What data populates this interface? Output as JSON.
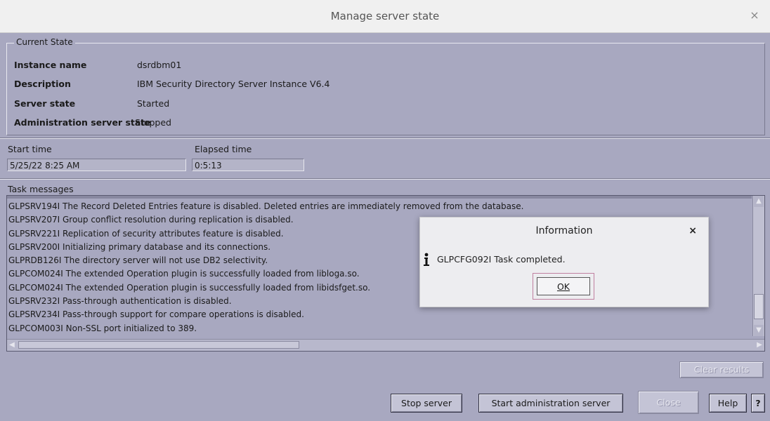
{
  "window": {
    "title": "Manage server state",
    "close_glyph": "×"
  },
  "current_state": {
    "legend": "Current State",
    "rows": [
      {
        "label": "Instance name",
        "value": "dsrdbm01"
      },
      {
        "label": "Description",
        "value": "IBM Security Directory Server Instance V6.4"
      },
      {
        "label": "Server state",
        "value": "Started"
      },
      {
        "label": "Administration server state",
        "value": "Stopped"
      }
    ]
  },
  "times": {
    "start_label": "Start time",
    "start_value": "5/25/22 8:25 AM",
    "elapsed_label": "Elapsed time",
    "elapsed_value": "0:5:13"
  },
  "task": {
    "label": "Task messages",
    "messages": [
      "GLPSRV194I The Record Deleted Entries feature is disabled. Deleted entries are immediately removed from the database.",
      "GLPSRV207I Group conflict resolution during replication is disabled.",
      "GLPSRV221I Replication of security attributes feature is disabled.",
      "GLPSRV200I Initializing primary database and its connections.",
      "GLPRDB126I The directory server will not use DB2 selectivity.",
      "GLPCOM024I The extended Operation plugin is successfully loaded from libloga.so.",
      "GLPCOM024I The extended Operation plugin is successfully loaded from libidsfget.so.",
      "GLPSRV232I Pass-through authentication is disabled.",
      "GLPSRV234I Pass-through support for compare operations is disabled.",
      "GLPCOM003I Non-SSL port initialized to 389."
    ]
  },
  "buttons": {
    "clear_results": "Clear results",
    "stop_server": "Stop server",
    "start_admin": "Start administration server",
    "close": "Close",
    "help": "Help",
    "question": "?"
  },
  "dialog": {
    "title": "Information",
    "close_glyph": "×",
    "message": "GLPCFG092I Task completed.",
    "ok": "OK"
  }
}
